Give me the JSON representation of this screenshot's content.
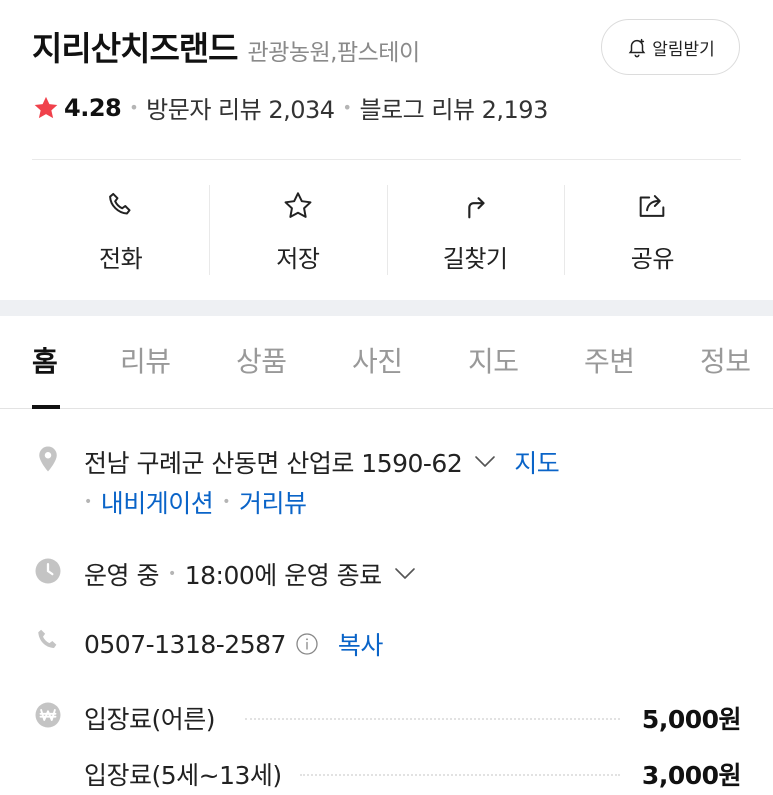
{
  "header": {
    "place_name": "지리산치즈랜드",
    "category": "관광농원,팜스테이",
    "notify_label": "알림받기",
    "rating": "4.28",
    "visitor_review": "방문자 리뷰 2,034",
    "blog_review": "블로그 리뷰 2,193"
  },
  "actions": {
    "call": "전화",
    "save": "저장",
    "directions": "길찾기",
    "share": "공유"
  },
  "tabs": [
    "홈",
    "리뷰",
    "상품",
    "사진",
    "지도",
    "주변",
    "정보"
  ],
  "info": {
    "address": "전남 구례군 산동면 산업로 1590-62",
    "map_link": "지도",
    "navigation_link": "내비게이션",
    "street_view_link": "거리뷰",
    "hours_status": "운영 중",
    "hours_detail": "18:00에 운영 종료",
    "phone": "0507-1318-2587",
    "copy_link": "복사",
    "fees": [
      {
        "label": "입장료(어른)",
        "price": "5,000원"
      },
      {
        "label": "입장료(5세~13세)",
        "price": "3,000원"
      }
    ]
  },
  "colors": {
    "link": "#0a64c8",
    "star": "#f0414b",
    "band": "#eef0f3"
  }
}
